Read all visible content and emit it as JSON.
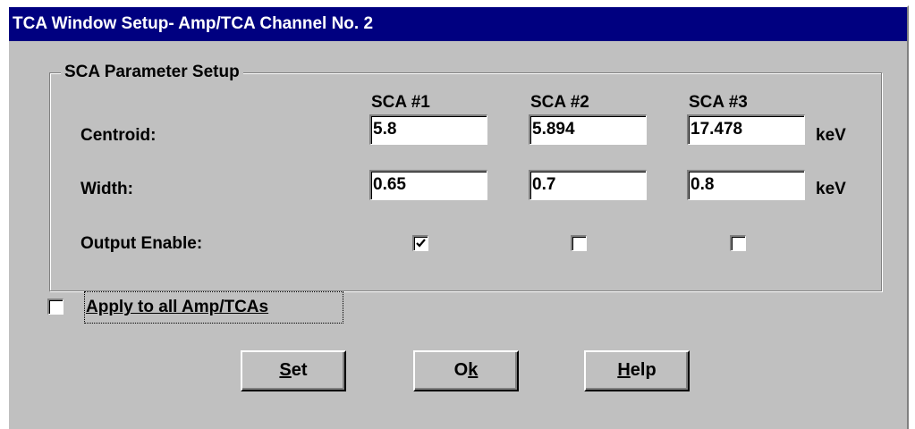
{
  "window": {
    "title": "TCA Window Setup- Amp/TCA Channel No. 2"
  },
  "group": {
    "title": "SCA Parameter Setup",
    "columns": [
      "SCA #1",
      "SCA #2",
      "SCA #3"
    ],
    "rows": {
      "centroid": {
        "label": "Centroid:",
        "values": [
          "5.8",
          "5.894",
          "17.478"
        ],
        "unit": "keV"
      },
      "width": {
        "label": "Width:",
        "values": [
          "0.65",
          "0.7",
          "0.8"
        ],
        "unit": "keV"
      },
      "output_enable": {
        "label": "Output Enable:",
        "checked": [
          true,
          false,
          false
        ]
      }
    }
  },
  "apply_all": {
    "label": "Apply to all Amp/TCAs",
    "checked": false
  },
  "buttons": {
    "set": {
      "mnemonic": "S",
      "rest": "et"
    },
    "ok": {
      "pre": "O",
      "mnemonic": "k"
    },
    "help": {
      "mnemonic": "H",
      "rest": "elp"
    }
  },
  "colors": {
    "titlebar": "#000080",
    "face": "#c0c0c0"
  }
}
